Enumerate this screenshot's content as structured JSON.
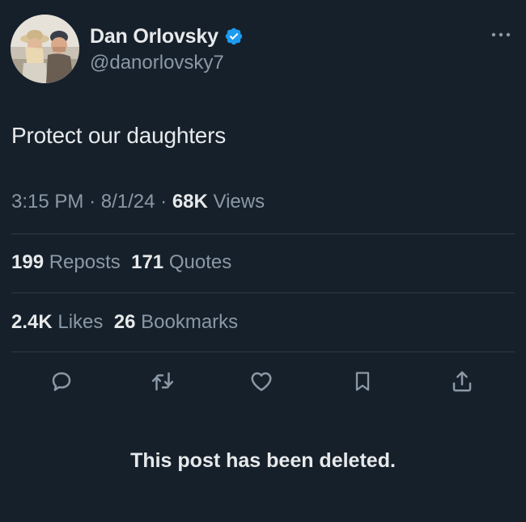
{
  "user": {
    "display_name": "Dan Orlovsky",
    "handle": "@danorlovsky7",
    "verified": true,
    "verified_color": "#1d9bf0"
  },
  "tweet": {
    "text": "Protect our daughters",
    "time": "3:15 PM",
    "separator": "·",
    "date": "8/1/24",
    "views_count": "68K",
    "views_label": "Views"
  },
  "stats": {
    "reposts_count": "199",
    "reposts_label": "Reposts",
    "quotes_count": "171",
    "quotes_label": "Quotes",
    "likes_count": "2.4K",
    "likes_label": "Likes",
    "bookmarks_count": "26",
    "bookmarks_label": "Bookmarks"
  },
  "actions": {
    "icons": [
      "reply-icon",
      "repost-icon",
      "like-icon",
      "bookmark-icon",
      "share-icon"
    ]
  },
  "notice": {
    "text": "This post has been deleted."
  },
  "colors": {
    "background": "#15202b",
    "primary_text": "#e7e9ea",
    "secondary_text": "#8b98a5",
    "divider": "#2f3a46"
  }
}
